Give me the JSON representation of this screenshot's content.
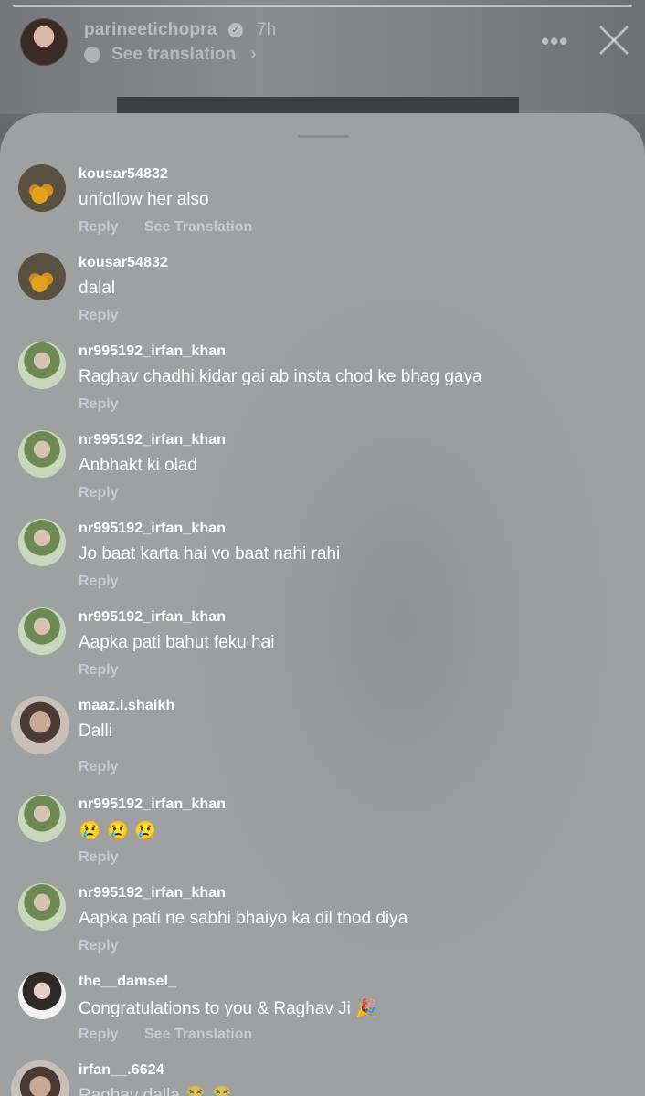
{
  "header": {
    "username": "parineetichopra",
    "time": "7h",
    "see_translation": "See translation",
    "verified_glyph": "✓",
    "chevron_glyph": "›",
    "more_glyph": "•••",
    "icons": [
      "avatar",
      "verified-badge-icon",
      "translate-icon",
      "chevron-right-icon",
      "more-options-icon",
      "close-icon"
    ]
  },
  "sheet": {
    "comments": [
      {
        "username": "kousar54832",
        "text": "unfollow her also",
        "reply": "Reply",
        "see_translation": "See Translation",
        "avatar": "flowers"
      },
      {
        "username": "kousar54832",
        "text": "dalal",
        "reply": "Reply",
        "avatar": "flowers"
      },
      {
        "username": "nr995192_irfan_khan",
        "text": "Raghav chadhi kidar gai ab insta chod ke bhag gaya",
        "reply": "Reply",
        "avatar": "guy"
      },
      {
        "username": "nr995192_irfan_khan",
        "text": "Anbhakt ki olad",
        "reply": "Reply",
        "avatar": "guy"
      },
      {
        "username": "nr995192_irfan_khan",
        "text": "Jo baat karta hai vo baat nahi rahi",
        "reply": "Reply",
        "avatar": "guy"
      },
      {
        "username": "nr995192_irfan_khan",
        "text": "Aapka pati bahut feku hai",
        "reply": "Reply",
        "avatar": "guy"
      },
      {
        "username": "maaz.i.shaikh",
        "text": "Dalli",
        "reply": "Reply",
        "avatar": "ring"
      },
      {
        "username": "nr995192_irfan_khan",
        "text": "😢 😢 😢",
        "reply": "Reply",
        "avatar": "guy"
      },
      {
        "username": "nr995192_irfan_khan",
        "text": "Aapka pati ne sabhi bhaiyo ka dil thod diya",
        "reply": "Reply",
        "avatar": "guy"
      },
      {
        "username": "the__damsel_",
        "text": "Congratulations to you & Raghav Ji 🎉",
        "reply": "Reply",
        "see_translation": "See Translation",
        "avatar": "damsel"
      },
      {
        "username": "irfan__.6624",
        "text": "Raghav dalla 😂 😂",
        "avatar": "ring"
      }
    ]
  },
  "colors": {
    "sheet_bg": "#9ea1a2",
    "username": "#ffffff",
    "comment_text": "#ffffff",
    "reply_link": "#cdd7e4"
  }
}
